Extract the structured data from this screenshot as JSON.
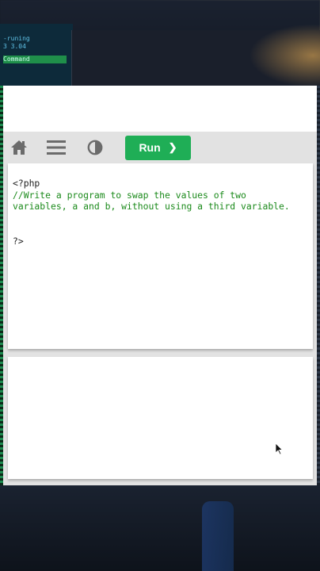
{
  "background": {
    "terminal_lines": [
      "-runing",
      "3 3.04"
    ],
    "terminal_green": "Command"
  },
  "toolbar": {
    "home_icon": "home-icon",
    "menu_icon": "menu-icon",
    "theme_icon": "contrast-icon",
    "run_label": "Run",
    "run_chevron": "❯"
  },
  "code": {
    "open_tag": "<?php",
    "comment_line1": "//Write a program to swap the values of two",
    "comment_line2": "variables, a and b, without using a third variable.",
    "close_tag": "?>"
  },
  "output": {
    "text": ""
  },
  "colors": {
    "run_button": "#1fae56",
    "comment": "#1b8a1b",
    "toolbar": "#e2e2e2"
  }
}
